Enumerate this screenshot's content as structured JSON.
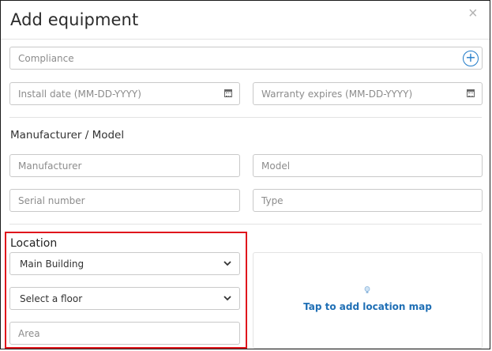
{
  "dialog": {
    "title": "Add equipment",
    "close_symbol": "×"
  },
  "fields": {
    "compliance_placeholder": "Compliance",
    "install_date_placeholder": "Install date (MM-DD-YYYY)",
    "warranty_placeholder": "Warranty expires (MM-DD-YYYY)",
    "manufacturer_placeholder": "Manufacturer",
    "model_placeholder": "Model",
    "serial_placeholder": "Serial number",
    "type_placeholder": "Type",
    "area_placeholder": "Area"
  },
  "sections": {
    "manufacturer_model": "Manufacturer / Model",
    "location": "Location"
  },
  "location": {
    "building_selected": "Main Building",
    "floor_selected": "Select a floor",
    "map_link": "Tap to add location map"
  },
  "icons": {
    "add": "plus-circle-icon",
    "calendar": "calendar-icon",
    "chevron": "chevron-down-icon",
    "bulb": "lightbulb-icon",
    "close": "close-icon"
  },
  "colors": {
    "accent": "#1f7ac8",
    "highlight": "#e0161c"
  }
}
